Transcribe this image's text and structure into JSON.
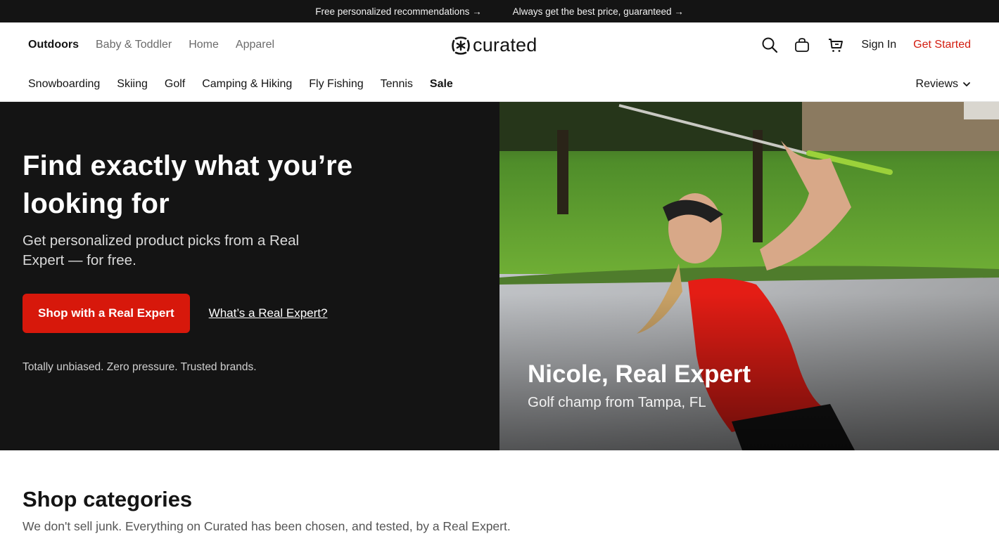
{
  "promo": {
    "items": [
      {
        "label": "Free personalized recommendations →"
      },
      {
        "label": "Always get the best price, guaranteed →"
      }
    ]
  },
  "header": {
    "verticals": [
      {
        "label": "Outdoors",
        "active": true
      },
      {
        "label": "Baby & Toddler",
        "active": false
      },
      {
        "label": "Home",
        "active": false
      },
      {
        "label": "Apparel",
        "active": false
      }
    ],
    "logo_text": "curated",
    "icons": [
      "search-icon",
      "bag-icon",
      "cart-icon"
    ],
    "sign_in": "Sign In",
    "get_started": "Get Started",
    "categories": [
      {
        "label": "Snowboarding"
      },
      {
        "label": "Skiing"
      },
      {
        "label": "Golf"
      },
      {
        "label": "Camping & Hiking"
      },
      {
        "label": "Fly Fishing"
      },
      {
        "label": "Tennis"
      },
      {
        "label": "Sale",
        "bold": true
      }
    ],
    "reviews": "Reviews"
  },
  "hero": {
    "title": "Find exactly what you’re looking for",
    "subtitle": "Get personalized product picks from a Real Expert — for free.",
    "primary_button": "Shop with a Real Expert",
    "secondary_link": "What’s a Real Expert?",
    "note": "Totally unbiased. Zero pressure. Trusted brands.",
    "expert": {
      "name": "Nicole, Real Expert",
      "description": "Golf champ from Tampa, FL"
    }
  },
  "shop_categories": {
    "title": "Shop categories",
    "subtitle": "We don't sell junk. Everything on Curated has been chosen, and tested, by a Real Expert."
  },
  "colors": {
    "accent": "#d7180b",
    "dark": "#141414",
    "get_started": "#d31c0f"
  }
}
